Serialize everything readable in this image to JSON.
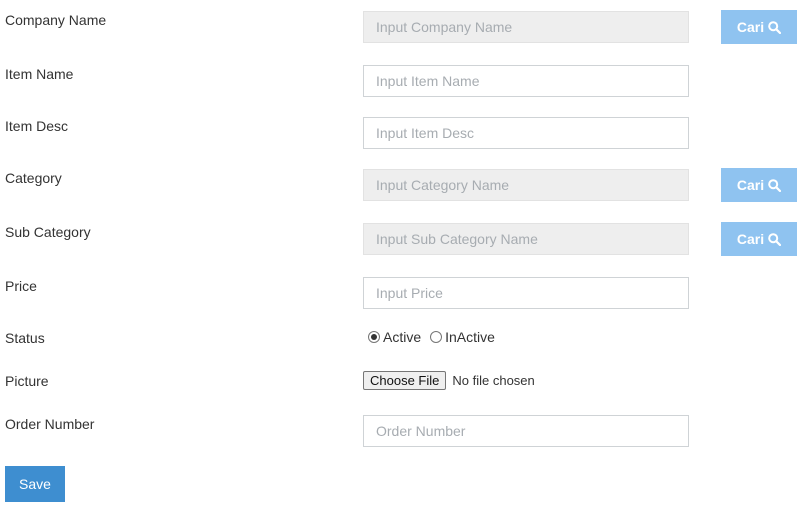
{
  "form": {
    "company": {
      "label": "Company Name",
      "placeholder": "Input Company Name",
      "button": "Cari"
    },
    "item_name": {
      "label": "Item Name",
      "placeholder": "Input Item Name"
    },
    "item_desc": {
      "label": "Item Desc",
      "placeholder": "Input Item Desc"
    },
    "category": {
      "label": "Category",
      "placeholder": "Input Category Name",
      "button": "Cari"
    },
    "sub_category": {
      "label": "Sub Category",
      "placeholder": "Input Sub Category Name",
      "button": "Cari"
    },
    "price": {
      "label": "Price",
      "placeholder": "Input Price"
    },
    "status": {
      "label": "Status",
      "options": [
        "Active",
        "InActive"
      ],
      "selected": "Active"
    },
    "picture": {
      "label": "Picture",
      "button": "Choose File",
      "file_text": "No file chosen"
    },
    "order_number": {
      "label": "Order Number",
      "placeholder": "Order Number"
    },
    "save_label": "Save"
  },
  "colors": {
    "cari_button": "#8fc3f0",
    "save_button": "#3e8ed0",
    "readonly_input_bg": "#eeeeee"
  },
  "icons": {
    "cari": "search-icon"
  }
}
